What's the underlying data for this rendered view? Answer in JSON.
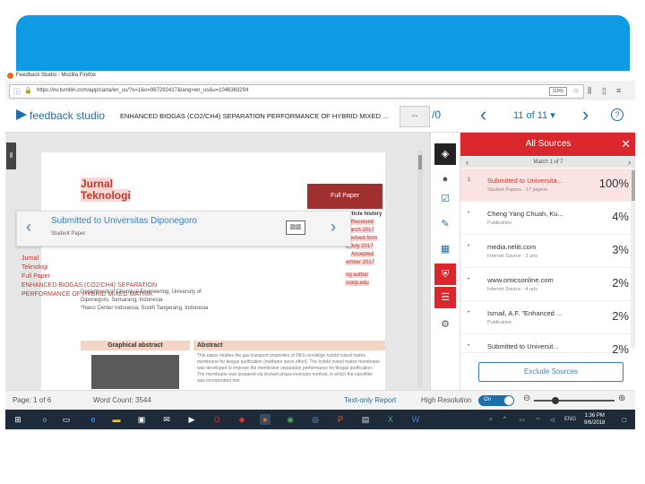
{
  "window": {
    "title": "Feedback Studio - Mozilla Firefox"
  },
  "browser": {
    "url": "https://ev.turnitin.com/app/carta/en_us/?s=1&o=997292417&lang=en_us&u=1046363294",
    "zoom": "110%"
  },
  "app": {
    "brand": "feedback studio",
    "doc_title": "ENHANCED BIOGAS (CO2/CH4) SEPARATION PERFORMANCE OF HYBRID MIXED ...",
    "score_placeholder": "--",
    "score_suffix": "/0",
    "match_nav": "11 of 11",
    "help": "?"
  },
  "document": {
    "title_lines": [
      "Jurnal",
      "Teknologi"
    ],
    "full_paper": "Full Paper",
    "article_history_label": "Article history",
    "article_history": [
      "Received",
      "March 2017",
      "Revised form",
      "8 July 2017",
      "Accepted",
      "ember 2017"
    ],
    "corr_lines": [
      "ng author",
      "nskip.edu"
    ],
    "affiliation_line": "Department of Chemical Engineering, University of",
    "affiliation_lines": [
      "Diponegoro, Semarang, Indonesia",
      "*Nano Center Indonesia, South Tangerang, Indonesia"
    ],
    "graphical_abstract": "Graphical abstract",
    "abstract_label": "Abstract",
    "abstract_text": "This paper studies the gas transport properties of PES-novolitige hybrid mixed matrix membrane for biogas purification (methane sieve effort). The hybrid mixed matrix membrane was developed to improve the membrane separation performance for biogas purification. The membrane was prepared via dry/wet phase inversion method, in which the nanofiller was incorporated into"
  },
  "popup": {
    "title": "Submitted to Universitas Diponegoro",
    "subtitle": "Student Paper",
    "matched_lines": [
      "Jurnal",
      "Teknologi",
      "Full Paper",
      "ENHANCED BIOGAS (CO2/CH4) SEPARATION",
      "PERFORMANCE OF HYBRID MIXED MATRIX"
    ]
  },
  "sources": {
    "header": "All Sources",
    "match_label": "Match 1 of 7",
    "items": [
      {
        "num": "1",
        "name": "Submitted to Universita...",
        "type": "Student Papers - 17 papers",
        "pct": "100%"
      },
      {
        "num": "2",
        "name": "Cheng Yang Chuah, Ku...",
        "type": "Publication",
        "pct": "4%"
      },
      {
        "num": "3",
        "name": "media.neliti.com",
        "type": "Internet Source - 3 urls",
        "pct": "3%"
      },
      {
        "num": "4",
        "name": "www.omicsonline.com",
        "type": "Internet Source - 4 urls",
        "pct": "2%"
      },
      {
        "num": "5",
        "name": "Ismail, A.F. \"Enhanced ...",
        "type": "Publication",
        "pct": "2%"
      },
      {
        "num": "6",
        "name": "Submitted to Universit...",
        "type": "",
        "pct": "2%"
      }
    ],
    "exclude_button": "Exclude Sources"
  },
  "status": {
    "page": "Page: 1 of 6",
    "word_count": "Word Count: 3544",
    "text_only": "Text-only Report",
    "high_res": "High Resolution",
    "toggle": "On"
  },
  "taskbar": {
    "lang": "ENG",
    "time": "1:36 PM",
    "date": "9/6/2018"
  },
  "colors": {
    "banner": "#0f9ae4",
    "accent": "#1e6fa8",
    "match_red": "#d9272d"
  }
}
